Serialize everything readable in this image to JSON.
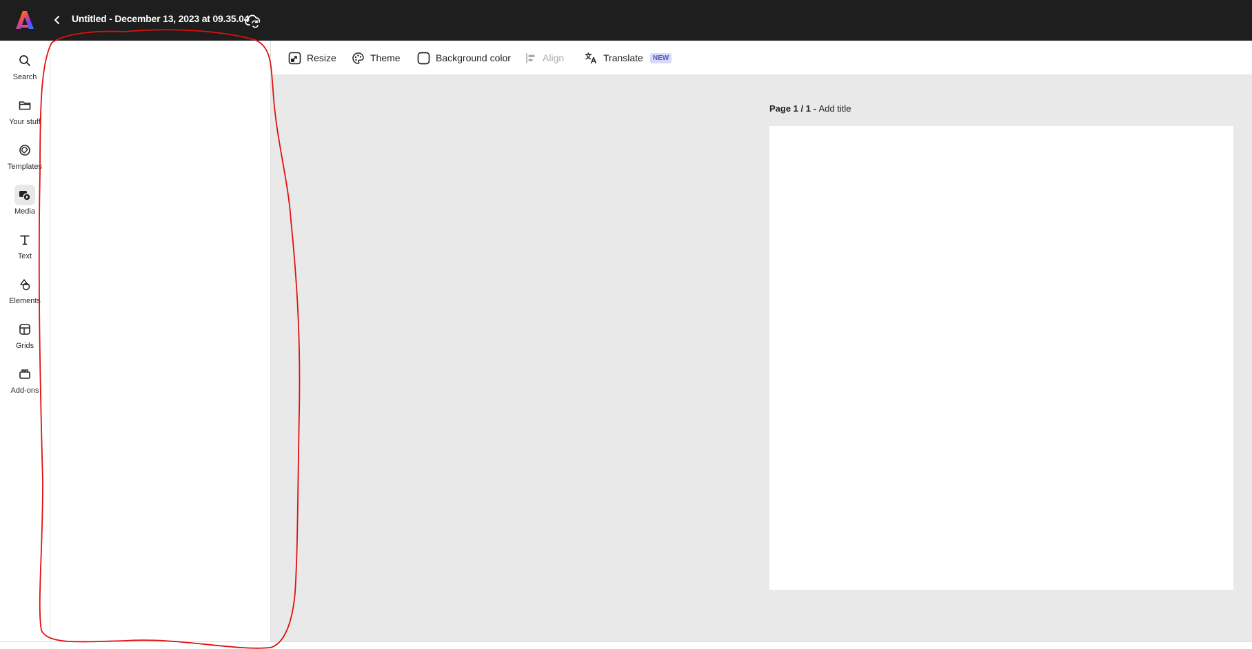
{
  "app": {
    "logo_icon": "adobe-express-logo",
    "brand_colors": [
      "#ff4f42",
      "#ffb000",
      "#7a3cff",
      "#1e88ff"
    ]
  },
  "header": {
    "back_icon": "chevron-left-icon",
    "title": "Untitled - December 13, 2023 at 09.35.04",
    "sync_icon": "cloud-sync-icon"
  },
  "rail": {
    "items": [
      {
        "id": "search",
        "label": "Search",
        "icon": "search-icon",
        "active": false
      },
      {
        "id": "your-stuff",
        "label": "Your stuff",
        "icon": "folder-icon",
        "active": false
      },
      {
        "id": "templates",
        "label": "Templates",
        "icon": "templates-icon",
        "active": false
      },
      {
        "id": "media",
        "label": "Media",
        "icon": "media-icon",
        "active": true
      },
      {
        "id": "text",
        "label": "Text",
        "icon": "text-icon",
        "active": false
      },
      {
        "id": "elements",
        "label": "Elements",
        "icon": "shapes-icon",
        "active": false
      },
      {
        "id": "grids",
        "label": "Grids",
        "icon": "grid-icon",
        "active": false
      },
      {
        "id": "add-ons",
        "label": "Add-ons",
        "icon": "addons-icon",
        "active": false
      }
    ]
  },
  "toolbar": {
    "resize": {
      "label": "Resize",
      "icon": "resize-icon"
    },
    "theme": {
      "label": "Theme",
      "icon": "palette-icon"
    },
    "background": {
      "label": "Background color",
      "icon": "rounded-square-icon"
    },
    "align": {
      "label": "Align",
      "icon": "align-left-icon",
      "disabled": true
    },
    "translate": {
      "label": "Translate",
      "icon": "translate-icon",
      "badge": "NEW"
    }
  },
  "canvas": {
    "page_prefix": "Page 1 / 1 -",
    "page_title_placeholder": "Add title",
    "background": "#e9e9e9"
  },
  "annotation": {
    "color": "#e01010"
  }
}
